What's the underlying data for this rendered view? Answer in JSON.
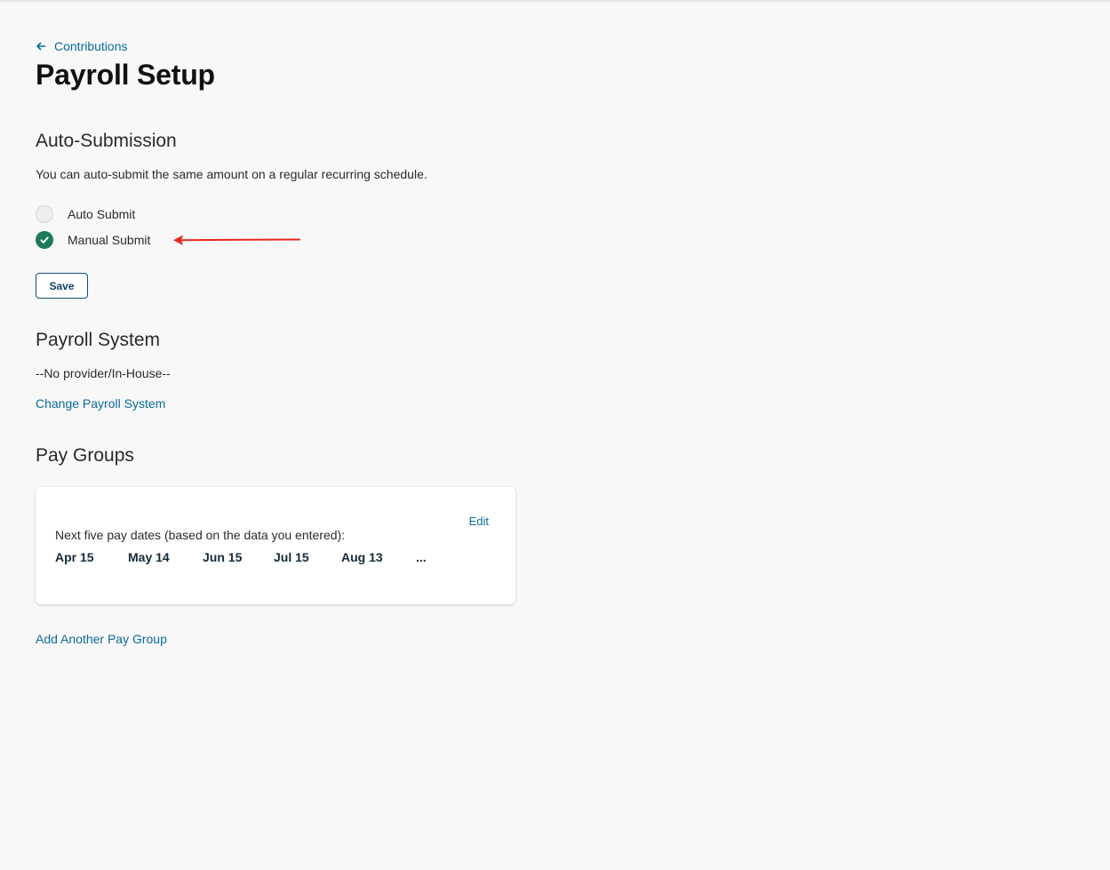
{
  "breadcrumb": {
    "back_label": "Contributions"
  },
  "page": {
    "title": "Payroll Setup"
  },
  "auto_submission": {
    "heading": "Auto-Submission",
    "description": "You can auto-submit the same amount on a regular recurring schedule.",
    "options": [
      {
        "label": "Auto Submit",
        "selected": false
      },
      {
        "label": "Manual Submit",
        "selected": true
      }
    ],
    "save_label": "Save"
  },
  "payroll_system": {
    "heading": "Payroll System",
    "provider": "--No provider/In-House--",
    "change_link": "Change Payroll System"
  },
  "pay_groups": {
    "heading": "Pay Groups",
    "card": {
      "edit_label": "Edit",
      "label": "Next five pay dates (based on the data you entered):",
      "dates": [
        "Apr 15",
        "May 14",
        "Jun 15",
        "Jul 15",
        "Aug 13",
        "..."
      ]
    },
    "add_link": "Add Another Pay Group"
  },
  "colors": {
    "link": "#0b6a9a",
    "radio_checked": "#1d7a5c",
    "annotation_arrow": "#e8261c",
    "button_border": "#0e4f73"
  }
}
